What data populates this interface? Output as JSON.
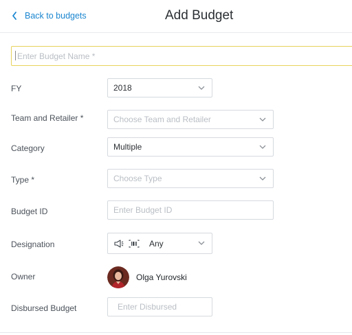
{
  "header": {
    "back_label": "Back to budgets",
    "title": "Add Budget"
  },
  "budget_name": {
    "placeholder": "Enter Budget Name *",
    "value": ""
  },
  "form": {
    "fy": {
      "label": "FY",
      "value": "2018"
    },
    "team_retailer": {
      "label": "Team and Retailer *",
      "placeholder": "Choose Team and Retailer"
    },
    "category": {
      "label": "Category",
      "value": "Multiple"
    },
    "type": {
      "label": "Type *",
      "placeholder": "Choose Type"
    },
    "budget_id": {
      "label": "Budget ID",
      "placeholder": "Enter Budget ID"
    },
    "designation": {
      "label": "Designation",
      "value": "Any",
      "icons": [
        "megaphone-icon",
        "barcode-icon"
      ]
    },
    "owner": {
      "label": "Owner",
      "name": "Olga Yurovski"
    },
    "disbursed": {
      "label": "Disbursed Budget",
      "placeholder": "Enter Disbursed"
    }
  },
  "colors": {
    "accent": "#1a86d0",
    "focus_border": "#e8d25a",
    "border": "#d5d9de",
    "placeholder": "#b9bec4"
  }
}
